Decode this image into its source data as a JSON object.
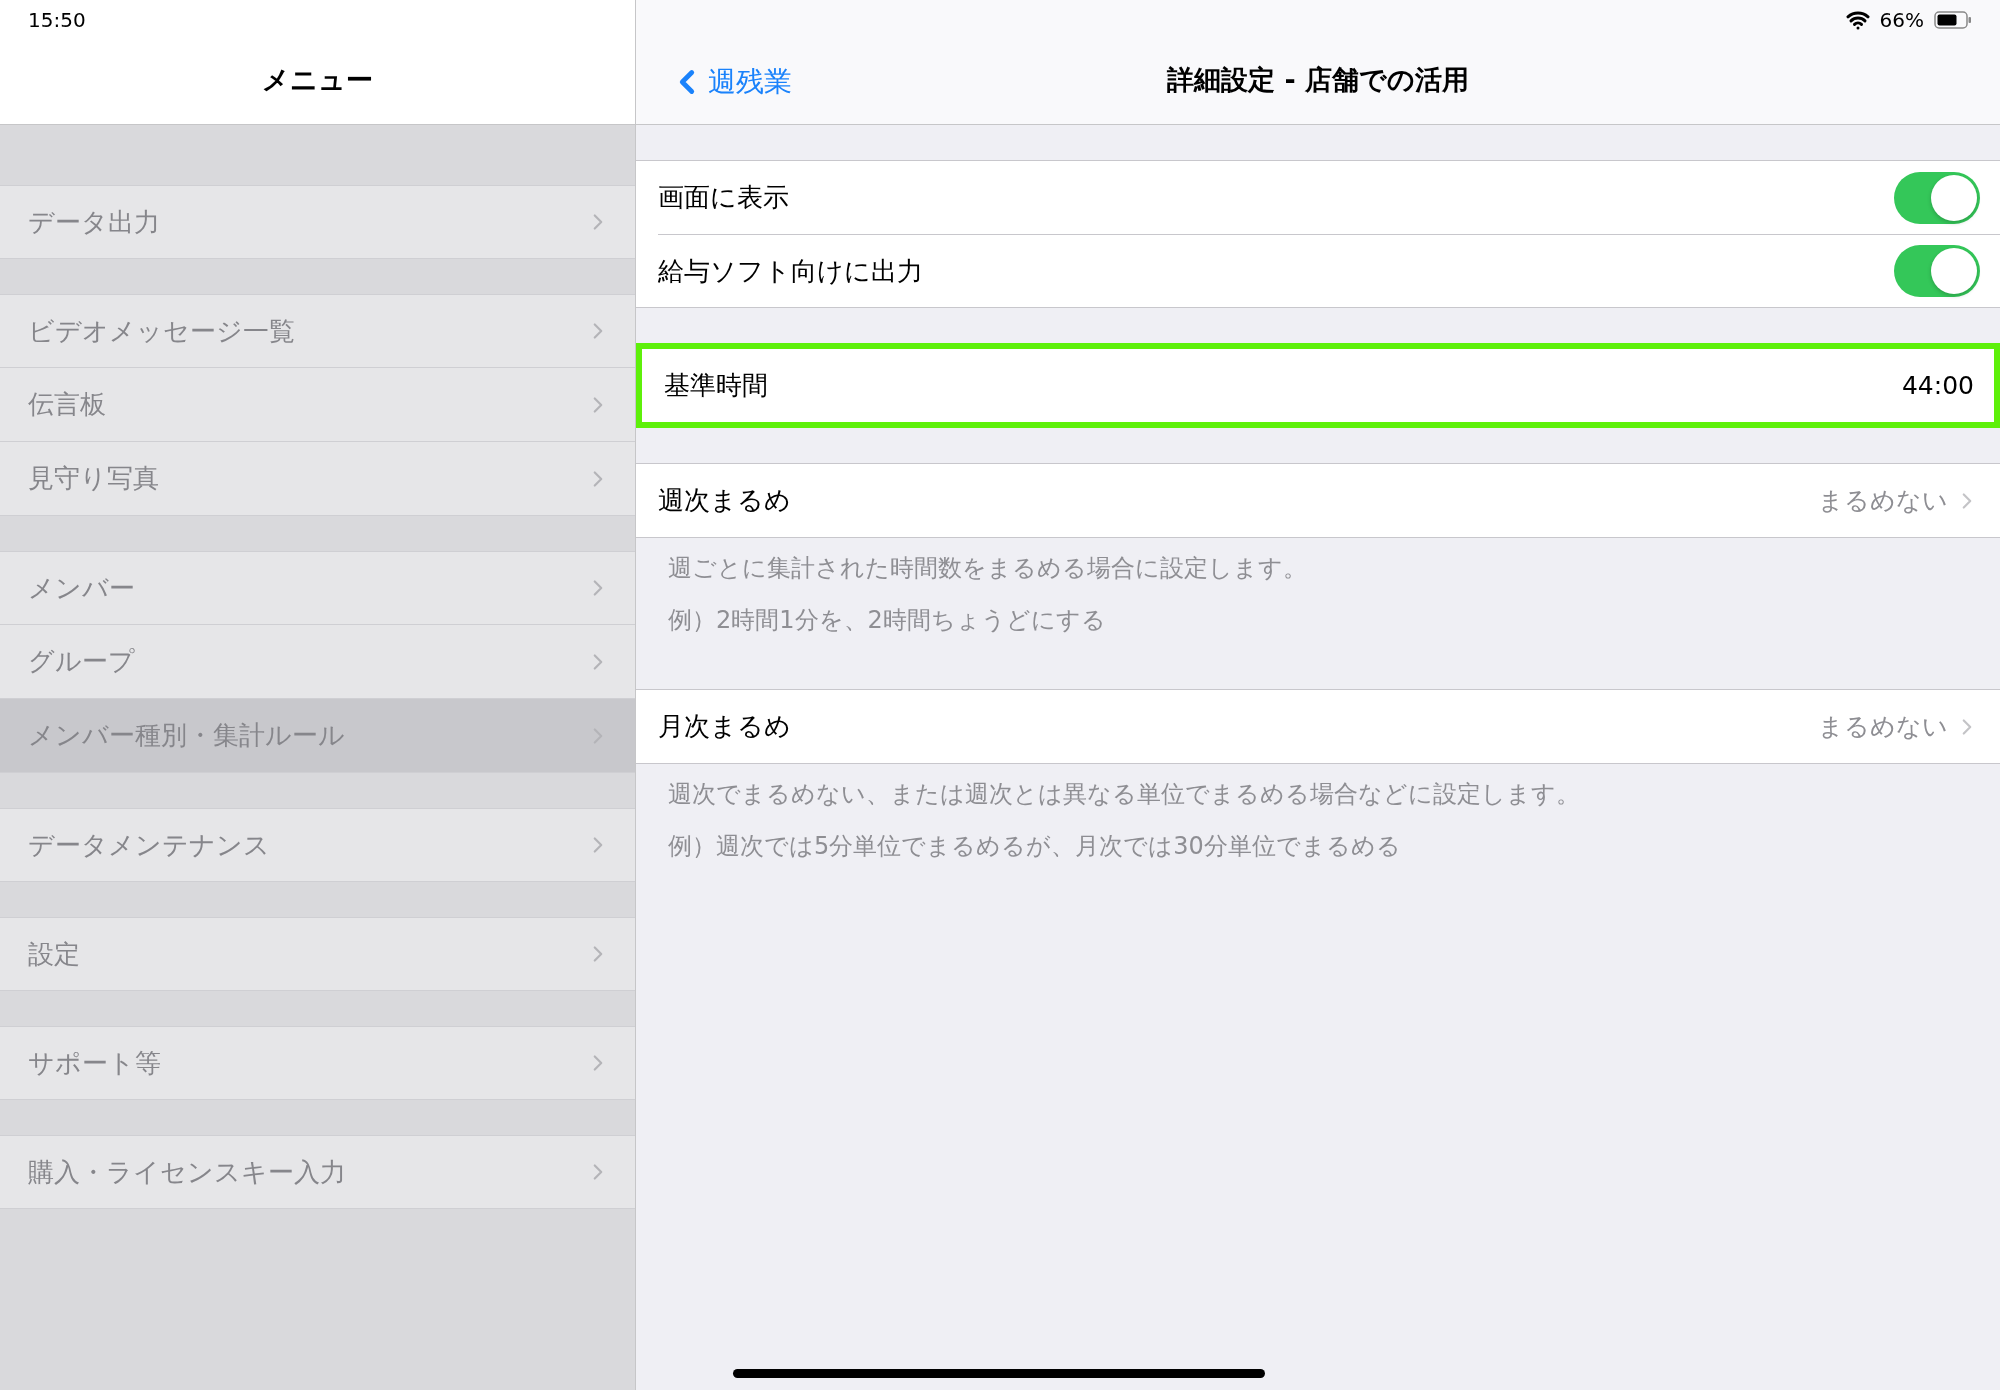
{
  "status_bar": {
    "time": "15:50",
    "battery": "66%"
  },
  "menu": {
    "title": "メニュー",
    "groups": [
      {
        "items": [
          {
            "label": "データ出力",
            "selected": false
          }
        ]
      },
      {
        "items": [
          {
            "label": "ビデオメッセージ一覧",
            "selected": false
          },
          {
            "label": "伝言板",
            "selected": false
          },
          {
            "label": "見守り写真",
            "selected": false
          }
        ]
      },
      {
        "items": [
          {
            "label": "メンバー",
            "selected": false
          },
          {
            "label": "グループ",
            "selected": false
          },
          {
            "label": "メンバー種別・集計ルール",
            "selected": true
          }
        ]
      },
      {
        "items": [
          {
            "label": "データメンテナンス",
            "selected": false
          }
        ]
      },
      {
        "items": [
          {
            "label": "設定",
            "selected": false
          }
        ]
      },
      {
        "items": [
          {
            "label": "サポート等",
            "selected": false
          }
        ]
      },
      {
        "items": [
          {
            "label": "購入・ライセンスキー入力",
            "selected": false
          }
        ]
      }
    ]
  },
  "detail": {
    "back": "週残業",
    "title": "詳細設定 - 店舗での活用",
    "sections": [
      {
        "highlighted": false,
        "rows": [
          {
            "kind": "toggle",
            "label": "画面に表示",
            "on": true
          },
          {
            "kind": "toggle",
            "label": "給与ソフト向けに出力",
            "on": true
          }
        ]
      },
      {
        "highlighted": true,
        "rows": [
          {
            "kind": "value",
            "label": "基準時間",
            "value": "44:00"
          }
        ]
      },
      {
        "highlighted": false,
        "rows": [
          {
            "kind": "disclosure",
            "label": "週次まるめ",
            "value": "まるめない"
          }
        ],
        "footer": [
          "週ごとに集計された時間数をまるめる場合に設定します。",
          "例）2時間1分を、2時間ちょうどにする"
        ]
      },
      {
        "highlighted": false,
        "rows": [
          {
            "kind": "disclosure",
            "label": "月次まるめ",
            "value": "まるめない"
          }
        ],
        "footer": [
          "週次でまるめない、または週次とは異なる単位でまるめる場合などに設定します。",
          "例）週次では5分単位でまるめるが、月次では30分単位でまるめる"
        ]
      }
    ]
  }
}
